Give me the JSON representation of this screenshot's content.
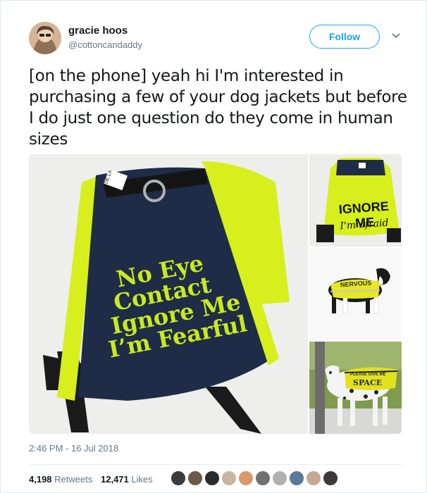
{
  "tweet": {
    "author_name": "gracie hoos",
    "author_handle": "@cottoncandaddy",
    "follow_label": "Follow",
    "text": "[on the phone] yeah hi I'm interested in purchasing a few of your dog jackets but before I do just one question do they come in human sizes",
    "timestamp": "2:46 PM - 16 Jul 2018",
    "retweets_count": "4,198",
    "retweets_label": "Retweets",
    "likes_count": "12,471",
    "likes_label": "Likes"
  },
  "media": {
    "main_vest_lines": [
      "No Eye",
      "Contact",
      "Ignore Me",
      "I’m Fearful"
    ],
    "main_tag": "DE LA",
    "thumb1_lines": [
      "IGNORE ME",
      "I'm afraid"
    ],
    "thumb2_text": "NERVOUS",
    "thumb3_lines": [
      "PLEASE GIVE ME",
      "SPACE"
    ]
  },
  "colors": {
    "accent": "#1da1f2",
    "neon": "#d9f21f",
    "denim": "#1f2c47",
    "vest_text": "#c7e81f"
  },
  "icons": {
    "chevron": "chevron-down-icon"
  }
}
